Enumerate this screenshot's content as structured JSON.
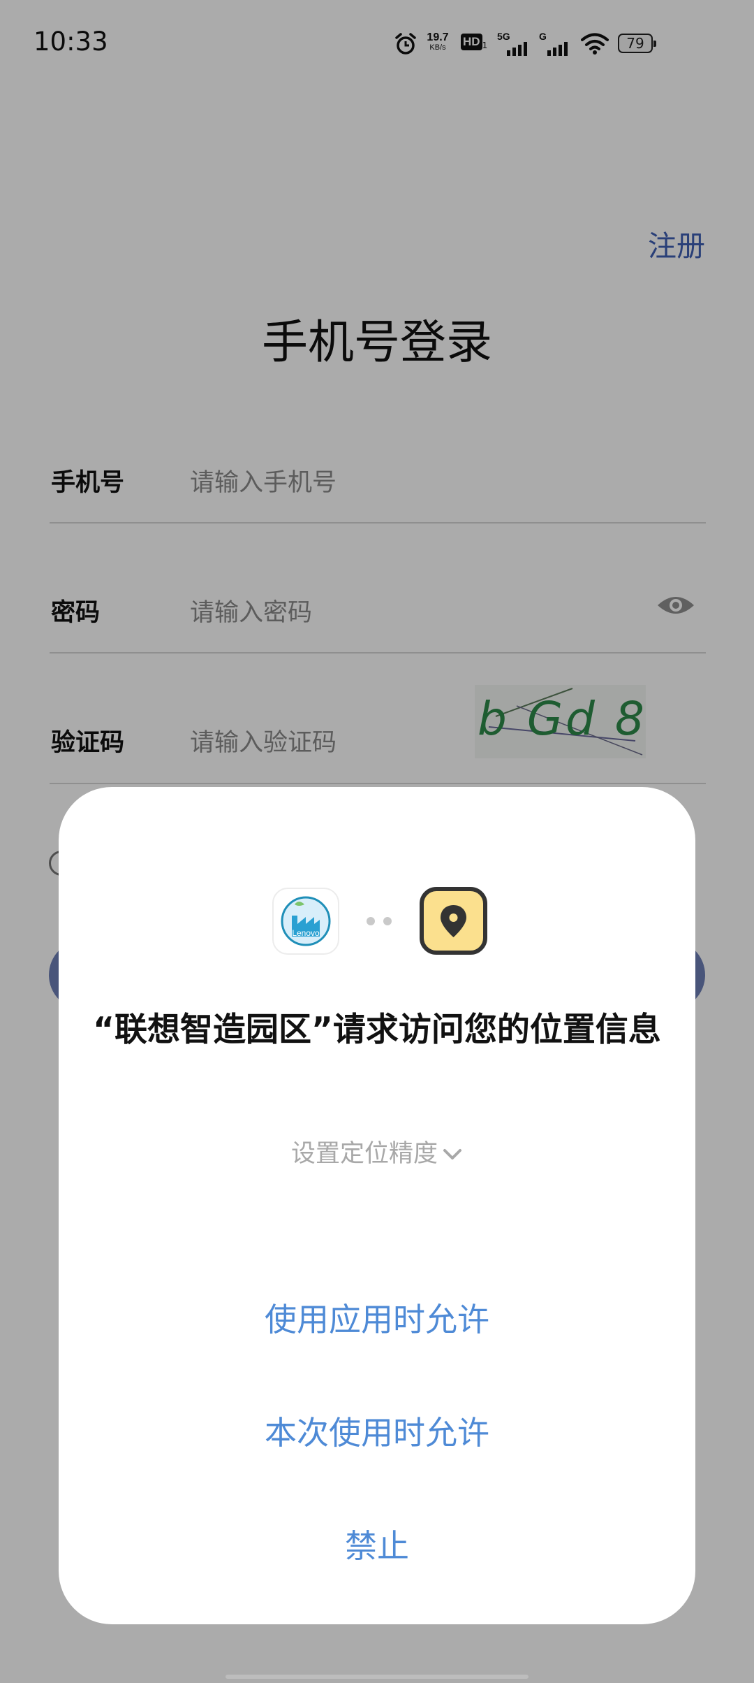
{
  "status_bar": {
    "time": "10:33",
    "net_speed_value": "19.7",
    "net_speed_unit": "KB/s",
    "hd_label": "HD",
    "hd_sub": "1",
    "sim1_label": "5G",
    "sim2_label": "G",
    "battery": "79"
  },
  "login": {
    "register_link": "注册",
    "title": "手机号登录",
    "phone_label": "手机号",
    "phone_placeholder": "请输入手机号",
    "password_label": "密码",
    "password_placeholder": "请输入密码",
    "captcha_label": "验证码",
    "captcha_placeholder": "请输入验证码",
    "captcha_text": "b Gd 8"
  },
  "dialog": {
    "app_icon_text": "Lenovo",
    "title": "“联想智造园区”请求访问您的位置信息",
    "accuracy_label": "设置定位精度",
    "btn_allow_while_using": "使用应用时允许",
    "btn_allow_once": "本次使用时允许",
    "btn_deny": "禁止"
  },
  "colors": {
    "accent_blue": "#4e8ad6",
    "link_blue": "#3e5fb4",
    "location_yellow": "#fbe08e"
  }
}
